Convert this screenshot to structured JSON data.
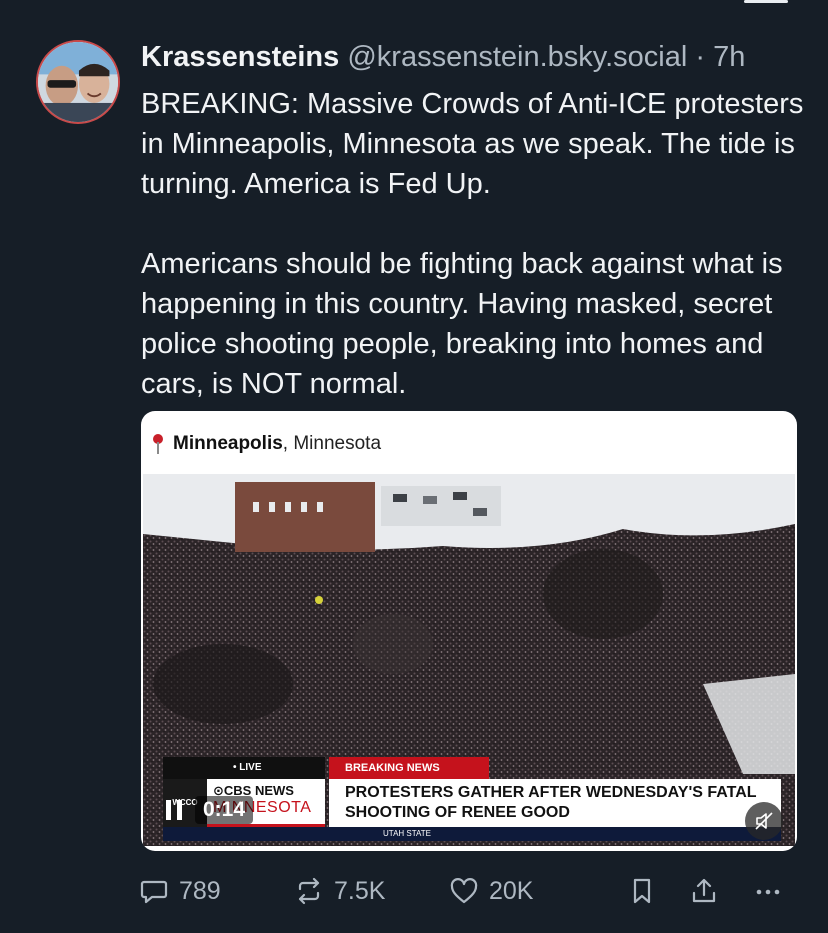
{
  "post": {
    "author_name": "Krassensteins",
    "handle": "@krassenstein.bsky.social",
    "separator": "·",
    "time": "7h",
    "text": "BREAKING: Massive Crowds of Anti-ICE protesters in Minneapolis, Minnesota as we speak.  The tide is turning.  America is Fed Up.\n\nAmericans should be fighting back against what is happening in this country.  Having masked, secret police shooting people, breaking into homes and cars, is NOT normal."
  },
  "embed": {
    "location_city": "Minneapolis",
    "location_rest": ", Minnesota",
    "video": {
      "live_label": "• LIVE",
      "breaking_label": "BREAKING NEWS",
      "station_logo": "WCCO",
      "network": "⊙CBS NEWS",
      "network_region": "MINNESOTA",
      "headline": "PROTESTERS GATHER AFTER WEDNESDAY'S FATAL SHOOTING OF RENEE GOOD",
      "ticker": "UTAH STATE",
      "timecode": "0:14"
    }
  },
  "actions": {
    "replies": "789",
    "reposts": "7.5K",
    "likes": "20K"
  },
  "icons": {
    "reply": "reply-icon",
    "repost": "repost-icon",
    "like": "heart-icon",
    "bookmark": "bookmark-icon",
    "share": "share-icon",
    "more": "more-icon",
    "pause": "pause-icon",
    "mute": "mute-icon",
    "pin": "location-pin-icon"
  },
  "colors": {
    "background": "#161e27",
    "text": "#f1f3f5",
    "muted": "#aeb8c2",
    "breaking_red": "#c5121c"
  }
}
